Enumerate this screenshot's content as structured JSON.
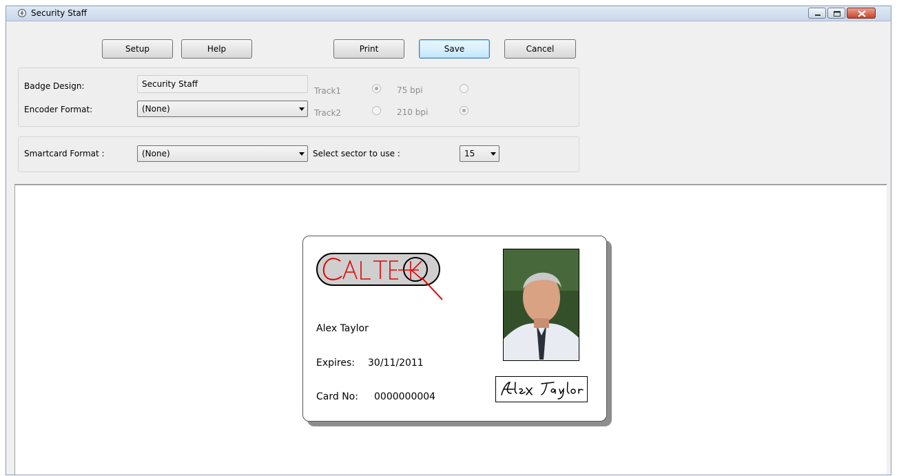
{
  "window": {
    "title": "Security Staff"
  },
  "toolbar": {
    "setup_label": "Setup",
    "help_label": "Help",
    "print_label": "Print",
    "save_label": "Save",
    "cancel_label": "Cancel"
  },
  "encoding": {
    "badge_design_label": "Badge Design:",
    "badge_design_value": "Security Staff",
    "encoder_format_label": "Encoder Format:",
    "encoder_format_value": "(None)",
    "track1_label": "Track1",
    "track2_label": "Track2",
    "bpi75_label": "75 bpi",
    "bpi210_label": "210 bpi"
  },
  "smartcard": {
    "format_label": "Smartcard Format :",
    "format_value": "(None)",
    "sector_label": "Select sector to use :",
    "sector_value": "15"
  },
  "badge": {
    "logo_text": "CALTEK",
    "name": "Alex Taylor",
    "expires_label": "Expires:",
    "expires_value": "30/11/2011",
    "card_no_label": "Card No:",
    "card_no_value": "0000000004",
    "signature_text": "Alex Taylor"
  }
}
